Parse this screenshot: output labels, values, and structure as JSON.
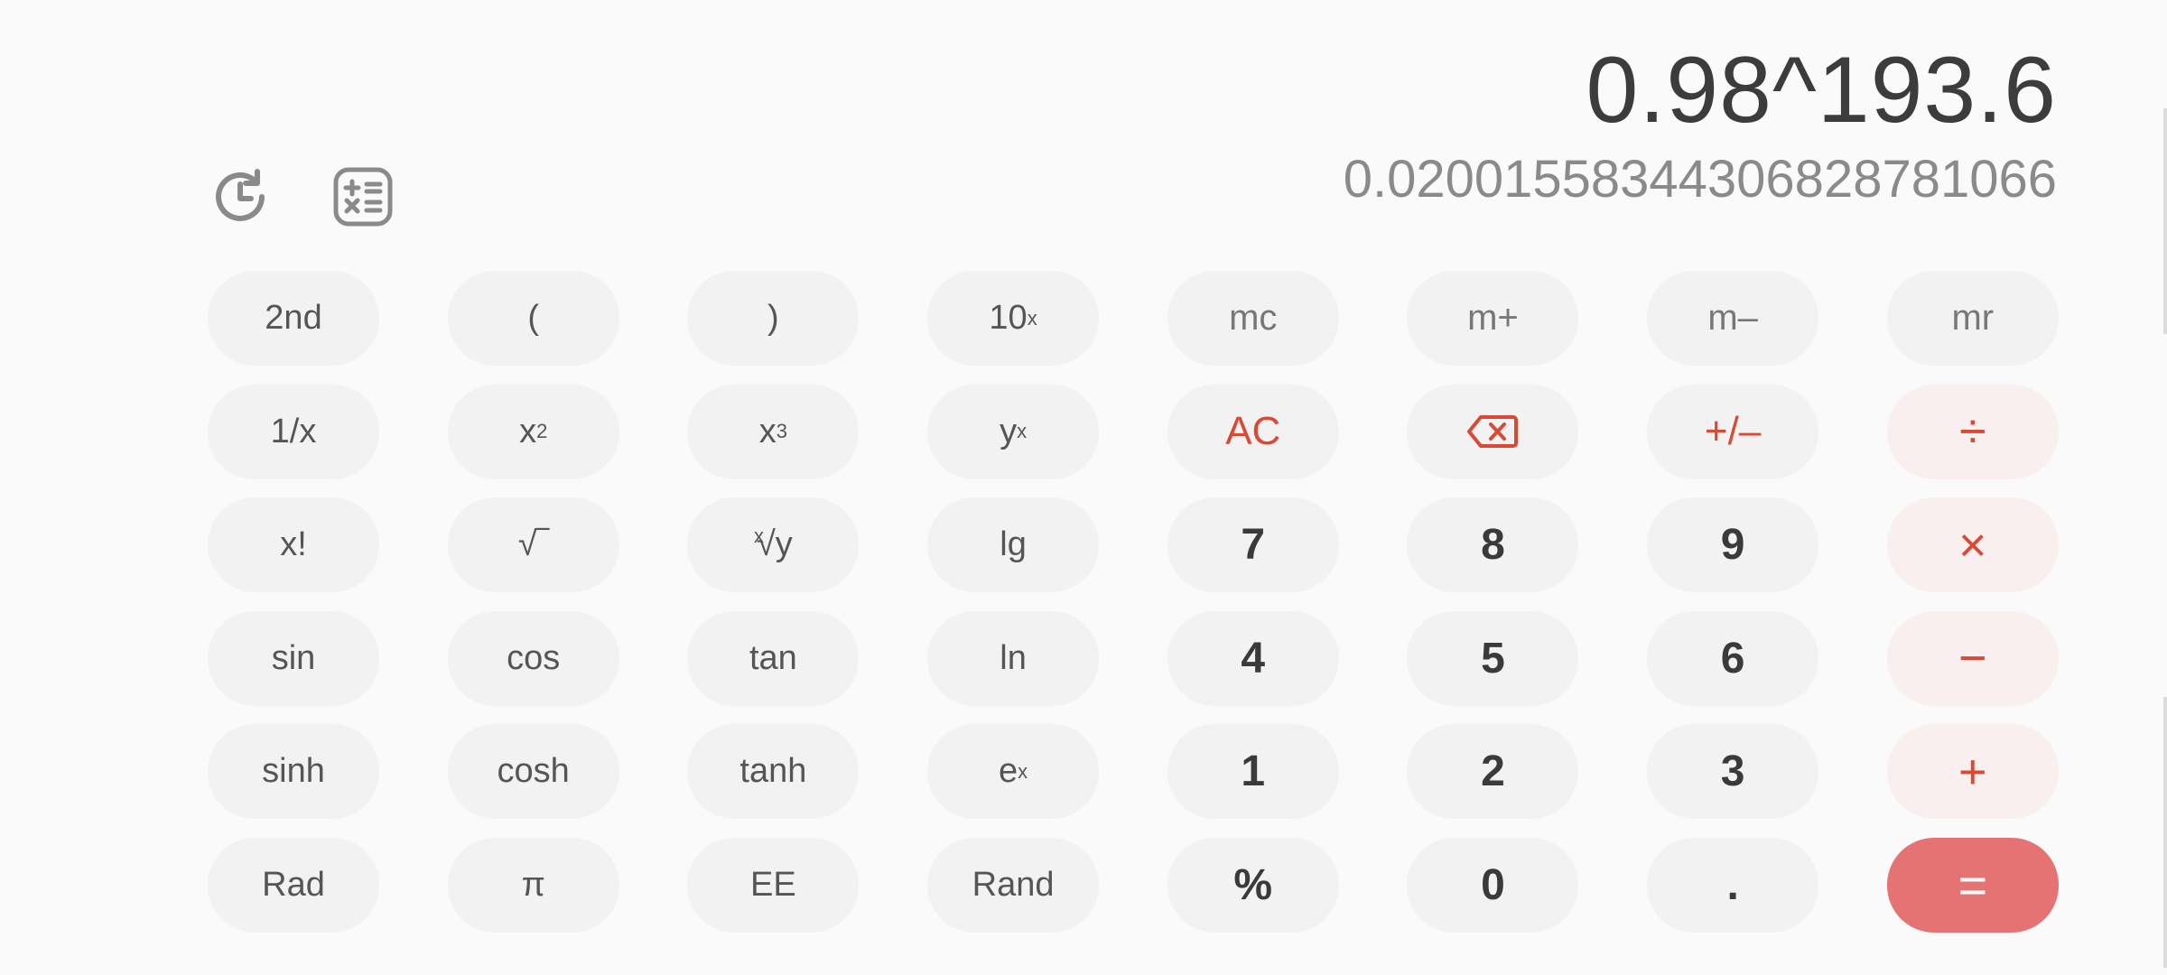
{
  "display": {
    "expression": "0.98^193.6",
    "result": "0.020015583443068287810 66"
  },
  "toolbar": {
    "history_icon": "history-icon",
    "converter_icon": "unit-converter-icon"
  },
  "keys": {
    "second": "2nd",
    "paren_open": "(",
    "paren_close": ")",
    "ten_pow_base": "10",
    "ten_pow_sup": "x",
    "mc": "mc",
    "m_plus": "m+",
    "m_minus": "m–",
    "mr": "mr",
    "reciprocal": "1/x",
    "x_base": "x",
    "sq_sup": "2",
    "cube_sup": "3",
    "y_base": "y",
    "ypow_sup": "x",
    "ac": "AC",
    "backspace_icon": "backspace-icon",
    "plus_minus": "+/–",
    "divide": "÷",
    "factorial": "x!",
    "sqrt": "√‾",
    "root_index": "x",
    "root_symbol": "√y",
    "lg": "lg",
    "seven": "7",
    "eight": "8",
    "nine": "9",
    "multiply": "×",
    "sin": "sin",
    "cos": "cos",
    "tan": "tan",
    "ln": "ln",
    "four": "4",
    "five": "5",
    "six": "6",
    "minus": "−",
    "sinh": "sinh",
    "cosh": "cosh",
    "tanh": "tanh",
    "e_base": "e",
    "e_sup": "x",
    "one": "1",
    "two": "2",
    "three": "3",
    "plus": "+",
    "rad": "Rad",
    "pi": "π",
    "ee": "EE",
    "rand": "Rand",
    "percent": "%",
    "zero": "0",
    "dot": ".",
    "equals": "="
  },
  "colors": {
    "accent": "#d84a35",
    "equals_bg": "#e57373",
    "key_bg": "#f2f2f2",
    "op_bg": "#f9efef"
  }
}
